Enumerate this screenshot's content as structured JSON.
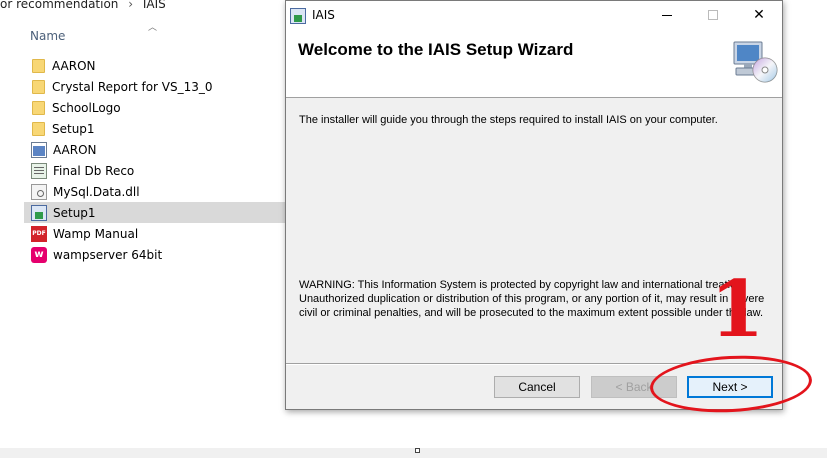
{
  "explorer": {
    "breadcrumb": [
      "or recommendation",
      "IAIS"
    ],
    "breadcrumb_separator": "›",
    "column_header": "Name",
    "files": [
      {
        "name": "AARON",
        "icon": "folder-icon",
        "kind": "folder"
      },
      {
        "name": "Crystal Report for VS_13_0",
        "icon": "folder-icon",
        "kind": "folder"
      },
      {
        "name": "SchoolLogo",
        "icon": "folder-icon",
        "kind": "folder"
      },
      {
        "name": "Setup1",
        "icon": "folder-icon",
        "kind": "folder"
      },
      {
        "name": "AARON",
        "icon": "application-icon",
        "kind": "exe"
      },
      {
        "name": "Final Db Reco",
        "icon": "document-icon",
        "kind": "doc"
      },
      {
        "name": "MySql.Data.dll",
        "icon": "dll-icon",
        "kind": "dll"
      },
      {
        "name": "Setup1",
        "icon": "setup-icon",
        "kind": "setup",
        "selected": true
      },
      {
        "name": "Wamp Manual",
        "icon": "pdf-icon",
        "kind": "pdf",
        "badge": "PDF"
      },
      {
        "name": "wampserver 64bit",
        "icon": "wamp-icon",
        "kind": "wamp",
        "badge": "w"
      }
    ]
  },
  "dialog": {
    "window_title": "IAIS",
    "close_glyph": "✕",
    "heading": "Welcome to the IAIS Setup Wizard",
    "intro": "The installer will guide you through the steps required to install IAIS on your computer.",
    "warning": "WARNING: This Information System is protected by copyright law and international treaties. Unauthorized duplication or distribution of this program, or any portion of it, may result in severe civil or criminal penalties, and will be prosecuted to the maximum extent possible under the law.",
    "buttons": {
      "cancel": "Cancel",
      "back": "< Back",
      "next": "Next >"
    }
  },
  "annotation": {
    "step_number": "1",
    "color": "#e3141c"
  },
  "colors": {
    "accent": "#0078d7",
    "selection": "#d9d9d9",
    "folder": "#f8d775"
  }
}
